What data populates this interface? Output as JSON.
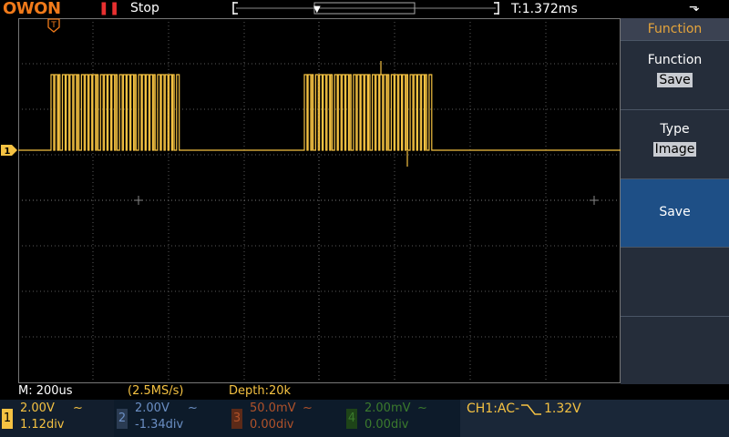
{
  "header": {
    "brand": "OWON",
    "run_icon": "pause-icon",
    "run_state": "Stop",
    "timebase": "T:1.372ms",
    "usb_icon": "usb-icon"
  },
  "panel": {
    "title": "Function",
    "items": [
      {
        "label": "Function",
        "value": "Save"
      },
      {
        "label": "Type",
        "value": "Image"
      },
      {
        "label": "Save",
        "value": ""
      },
      {
        "label": "",
        "value": ""
      },
      {
        "label": "",
        "value": ""
      }
    ]
  },
  "status": {
    "memory": "M: 200us",
    "rate": "(2.5MS/s)",
    "depth": "Depth:20k"
  },
  "channels": [
    {
      "num": "1",
      "volts": "2.00V",
      "coupling": "~",
      "offset": "1.12div",
      "color": "#f5c242"
    },
    {
      "num": "2",
      "volts": "2.00V",
      "coupling": "~",
      "offset": "-1.34div",
      "color": "#6b8fc4"
    },
    {
      "num": "3",
      "volts": "50.0mV",
      "coupling": "~",
      "offset": "0.00div",
      "color": "#b0522a"
    },
    {
      "num": "4",
      "volts": "2.00mV",
      "coupling": "~",
      "offset": "0.00div",
      "color": "#3b7a2d"
    }
  ],
  "trigger": {
    "source": "CH1:AC-",
    "edge_icon": "falling-edge-icon",
    "level": "1.32V"
  },
  "markers": {
    "trigger_marker": "T",
    "ch1_marker": "1"
  },
  "colors": {
    "trace": "#f5c242",
    "accent": "#e7a53b",
    "panel_active": "#1e4f86",
    "grid": "#6a6a6a"
  }
}
